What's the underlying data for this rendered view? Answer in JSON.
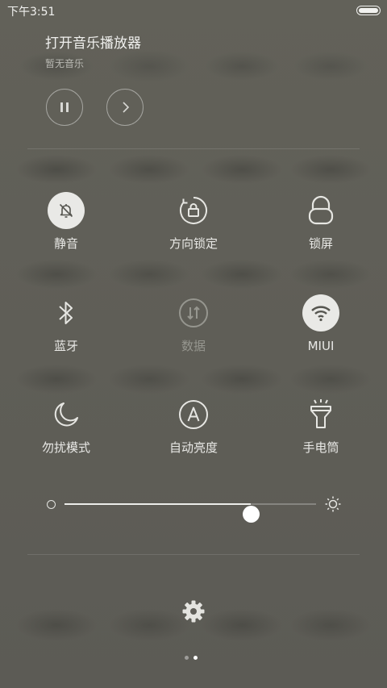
{
  "status_bar": {
    "time": "下午3:51"
  },
  "music": {
    "title": "打开音乐播放器",
    "subtitle": "暂无音乐",
    "pause_icon": "pause-icon",
    "next_icon": "chevron-right-icon"
  },
  "toggles": [
    {
      "label": "静音",
      "icon": "bell-off-icon",
      "active": true
    },
    {
      "label": "方向锁定",
      "icon": "rotation-lock-icon",
      "active": false
    },
    {
      "label": "锁屏",
      "icon": "lock-icon",
      "active": false
    },
    {
      "label": "蓝牙",
      "icon": "bluetooth-icon",
      "active": false
    },
    {
      "label": "数据",
      "icon": "mobile-data-icon",
      "active": false,
      "disabled": true
    },
    {
      "label": "MIUI",
      "icon": "wifi-icon",
      "active": true
    },
    {
      "label": "勿扰模式",
      "icon": "moon-icon",
      "active": false
    },
    {
      "label": "自动亮度",
      "icon": "auto-brightness-icon",
      "active": false
    },
    {
      "label": "手电筒",
      "icon": "flashlight-icon",
      "active": false
    }
  ],
  "brightness": {
    "level": 0.74,
    "min_icon": "brightness-low-icon",
    "max_icon": "brightness-high-icon"
  },
  "settings_icon": "gear-icon",
  "pager": {
    "pages": 2,
    "current": 2
  },
  "colors": {
    "background": "#5f5e58",
    "active_circle": "#e9e9e6",
    "active_glyph": "#5a5a55",
    "icon": "#e8e8e5",
    "disabled": "#96968f"
  }
}
